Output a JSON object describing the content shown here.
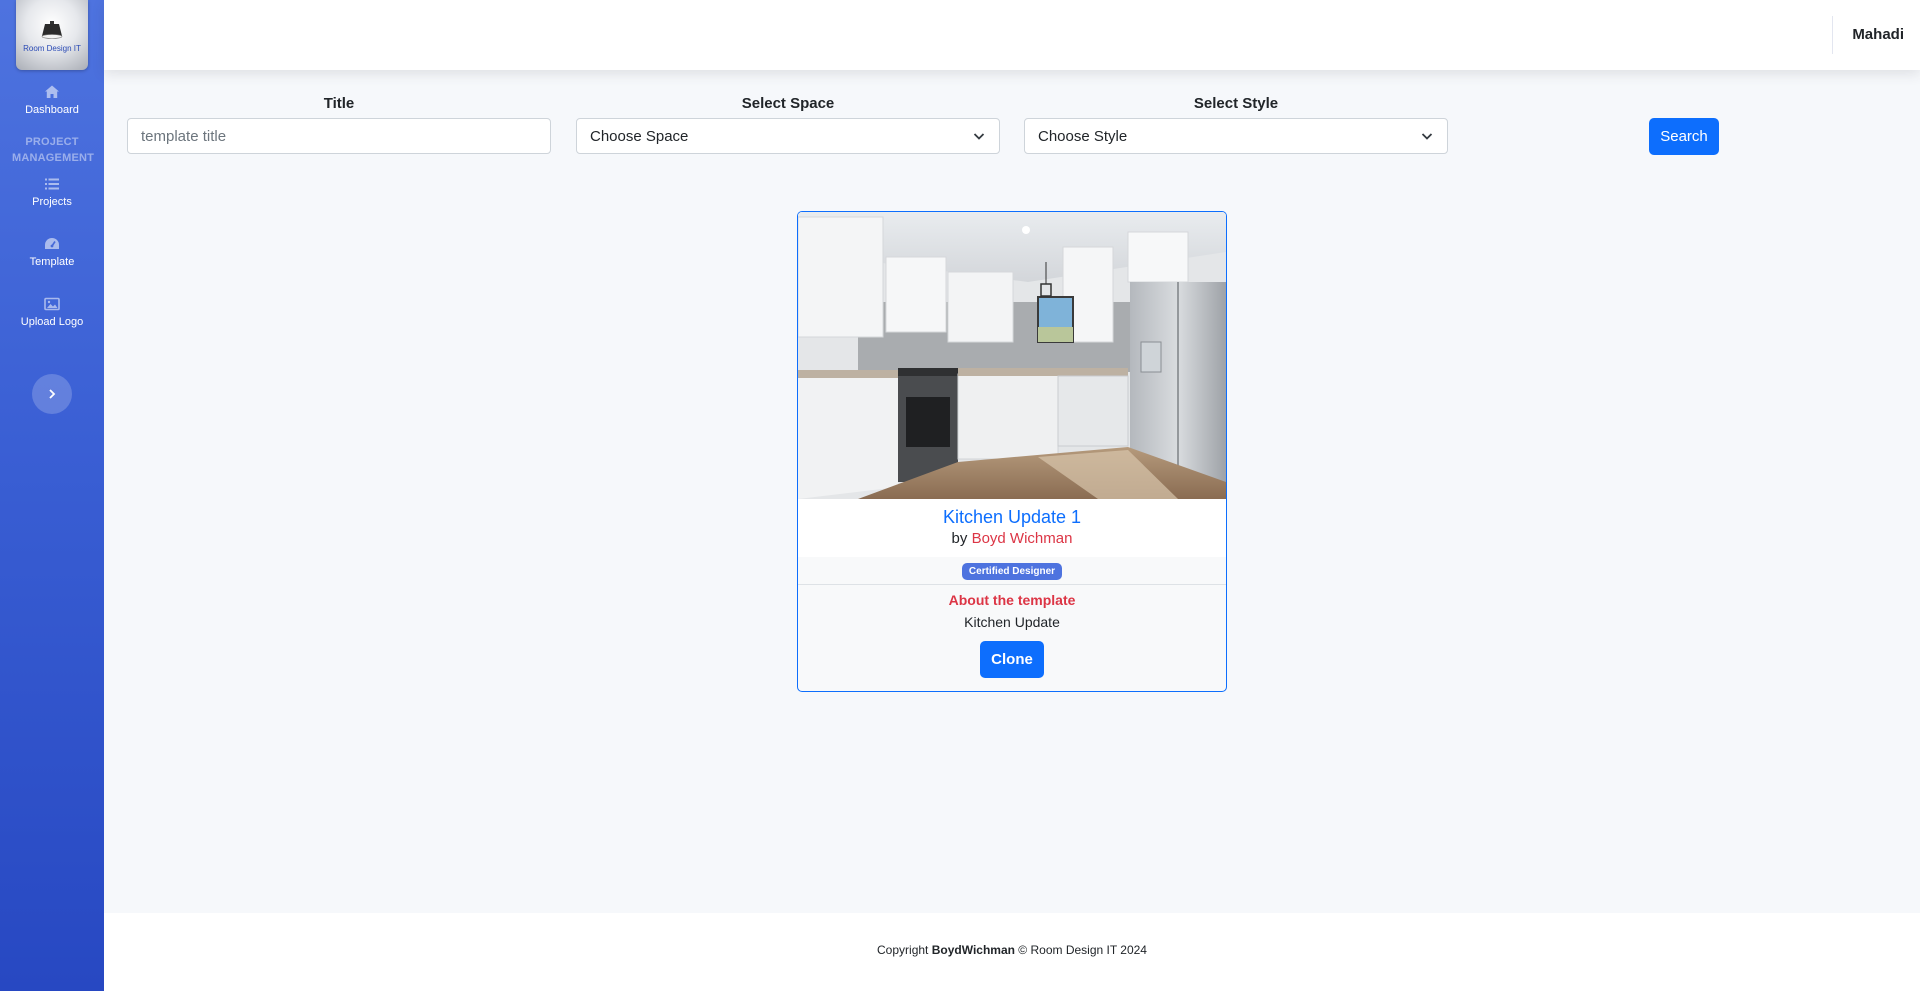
{
  "sidebar": {
    "logo_text": "Room Design IT",
    "items": [
      {
        "label": "Dashboard",
        "icon": "home-icon"
      },
      {
        "label": "Projects",
        "icon": "list-icon"
      },
      {
        "label": "Template",
        "icon": "gauge-icon"
      },
      {
        "label": "Upload Logo",
        "icon": "image-icon"
      }
    ],
    "heading": "PROJECT MANAGEMENT",
    "toggle_icon": "chevron-right-icon"
  },
  "topbar": {
    "user_name": "Mahadi"
  },
  "filters": {
    "title": {
      "label": "Title",
      "placeholder": "template title",
      "value": ""
    },
    "space": {
      "label": "Select Space",
      "selected": "Choose Space"
    },
    "style": {
      "label": "Select Style",
      "selected": "Choose Style"
    },
    "search_label": "Search"
  },
  "template_card": {
    "title": "Kitchen Update 1",
    "by_prefix": "by",
    "author": "Boyd Wichman",
    "badge": "Certified Designer",
    "about_label": "About the template",
    "about_text": "Kitchen Update",
    "clone_label": "Clone"
  },
  "footer": {
    "prefix": "Copyright",
    "owner": "BoydWichman",
    "suffix": "© Room Design IT 2024"
  },
  "colors": {
    "primary": "#0d6efd",
    "sidebar": "#4e73df",
    "author": "#dc3545",
    "badge": "#4e73df"
  }
}
